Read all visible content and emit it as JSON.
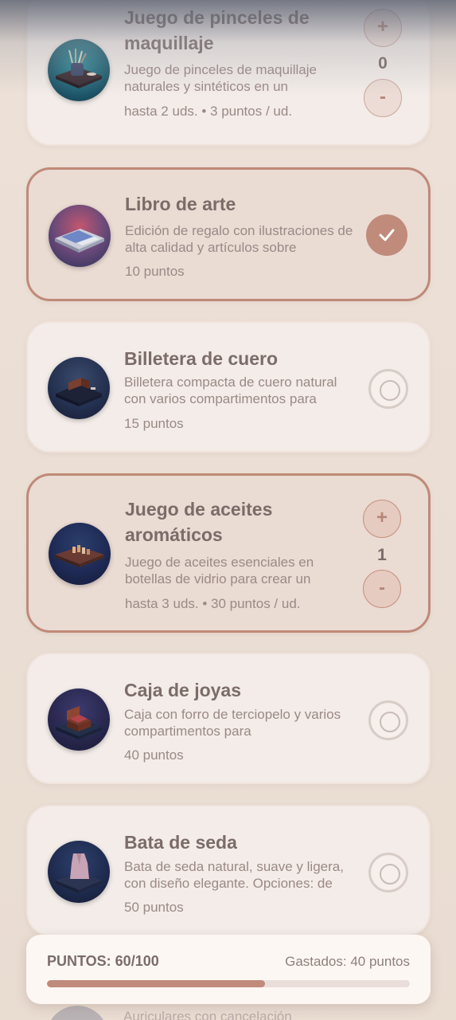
{
  "items": [
    {
      "title": "Juego de pinceles de maquillaje",
      "description": "Juego de pinceles de maquillaje naturales y sintéticos en un",
      "meta": "hasta 2 uds. • 3 puntos / ud.",
      "control": "stepper",
      "plus": "+",
      "quantity": "0",
      "minus": "-",
      "selected": false
    },
    {
      "title": "Libro de arte",
      "description": "Edición de regalo con ilustraciones de alta calidad y artículos sobre",
      "meta": "10 puntos",
      "control": "check",
      "selected": true
    },
    {
      "title": "Billetera de cuero",
      "description": "Billetera compacta de cuero natural con varios compartimentos para",
      "meta": "15 puntos",
      "control": "radio",
      "selected": false
    },
    {
      "title": "Juego de aceites aromáticos",
      "description": "Juego de aceites esenciales en botellas de vidrio para crear un",
      "meta": "hasta 3 uds. • 30 puntos / ud.",
      "control": "stepper",
      "plus": "+",
      "quantity": "1",
      "minus": "-",
      "selected": true
    },
    {
      "title": "Caja de joyas",
      "description": "Caja con forro de terciopelo y varios compartimentos para",
      "meta": "40 puntos",
      "control": "radio",
      "selected": false
    },
    {
      "title": "Bata de seda",
      "description": "Bata de seda natural, suave y ligera, con diseño elegante. Opciones: de",
      "meta": "50 puntos",
      "control": "radio",
      "selected": false
    },
    {
      "description": "Auriculares con cancelación"
    }
  ],
  "footer": {
    "points_label": "PUNTOS: 60/100",
    "spent_label": "Gastados: 40 puntos",
    "progress": 0.6
  },
  "colors": {
    "accent": "#c08b7b",
    "card": "#f3ece8",
    "card_selected": "#eadbd3",
    "text": "#7b6c69"
  }
}
